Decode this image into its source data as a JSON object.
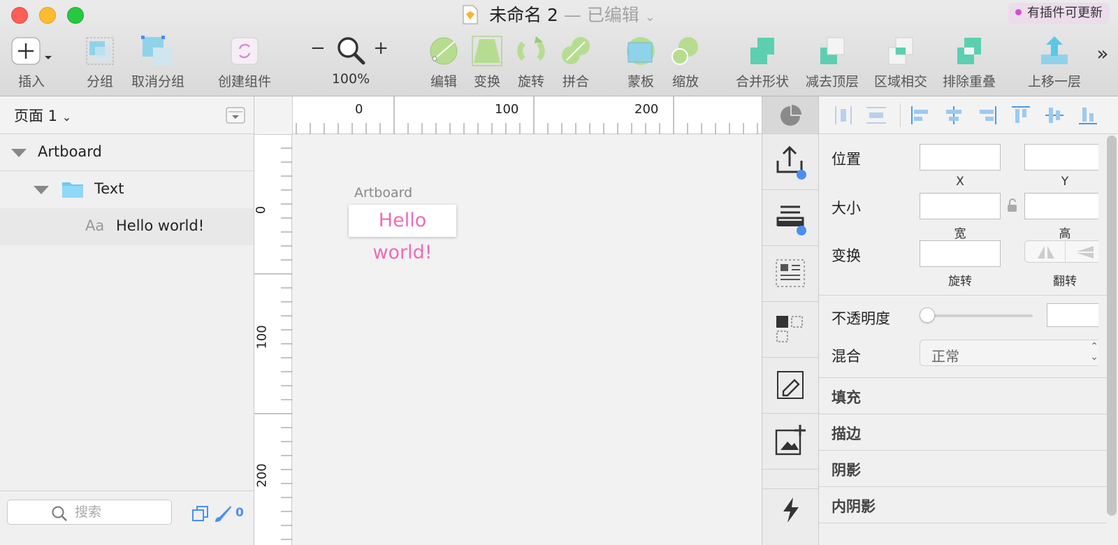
{
  "window": {
    "title": "未命名 2",
    "edited": "— 已编辑",
    "plugin_badge": "有插件可更新"
  },
  "toolbar": {
    "insert": "插入",
    "group": "分组",
    "ungroup": "取消分组",
    "create_symbol": "创建组件",
    "zoom_minus": "−",
    "zoom_plus": "+",
    "zoom_level": "100%",
    "edit": "编辑",
    "transform": "变换",
    "rotate": "旋转",
    "combine": "拼合",
    "mask": "蒙板",
    "scale": "缩放",
    "union": "合并形状",
    "subtract": "减去顶层",
    "intersect": "区域相交",
    "difference": "排除重叠",
    "forward": "上移一层",
    "more": "»"
  },
  "layers": {
    "page_name": "页面 1",
    "artboard": "Artboard",
    "group": "Text",
    "text_layer_prefix": "Aa",
    "text_layer": "Hello world!",
    "search_placeholder": "搜索",
    "selection_count": "0"
  },
  "ruler": {
    "top_labels": [
      "0",
      "100",
      "200"
    ],
    "left_labels": [
      "0",
      "100",
      "200"
    ]
  },
  "canvas": {
    "artboard_label": "Artboard",
    "text": "Hello world!"
  },
  "inspector": {
    "position": "位置",
    "x": "X",
    "y": "Y",
    "size": "大小",
    "width": "宽",
    "height": "高",
    "transform": "变换",
    "rotate": "旋转",
    "flip": "翻转",
    "opacity": "不透明度",
    "blend": "混合",
    "blend_value": "正常",
    "fill": "填充",
    "border": "描边",
    "shadow": "阴影",
    "inner_shadow": "内阴影"
  },
  "colors": {
    "accent_blue": "#4a8ef5",
    "text_pink": "#f06bb4",
    "traffic_red": "#fc5f57",
    "traffic_yellow": "#fdbc2e",
    "traffic_green": "#28c840"
  }
}
